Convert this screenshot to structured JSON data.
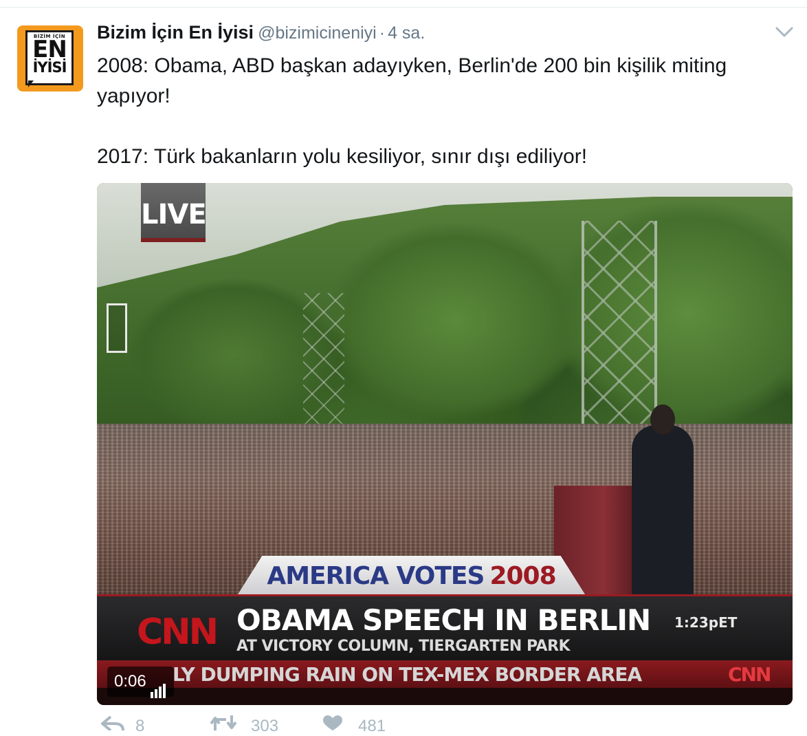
{
  "tweet": {
    "author": {
      "name": "Bizim İçin En İyisi",
      "handle": "@bizimicineniyi",
      "avatar": {
        "top_text": "BİZİM İÇİN",
        "big_text": "EN",
        "bottom_text": "İYİSİ",
        "background_color": "#f39a1e"
      }
    },
    "separator": "·",
    "time": "4 sa.",
    "text_lines": [
      "2008: Obama, ABD başkan adayıyken, Berlin'de 200 bin kişilik miting yapıyor!",
      "2017: Türk bakanların yolu kesiliyor, sınır dışı ediliyor!"
    ],
    "menu_icon": "chevron-down-icon"
  },
  "video": {
    "live_badge": "LIVE",
    "banner_text": "AMERICA VOTES",
    "banner_year": "2008",
    "network_logo": "CNN",
    "headline": "OBAMA SPEECH IN BERLIN",
    "subheadline": "AT VICTORY COLUMN, TIERGARTEN PARK",
    "clock": "1:23pET",
    "ticker_text": "LY DUMPING RAIN ON TEX-MEX BORDER AREA",
    "ticker_logo": "CNN",
    "timer": "0:06",
    "timer_icon": "volume-bars-icon"
  },
  "actions": {
    "reply_count": "8",
    "retweet_count": "303",
    "like_count": "481",
    "reply_icon": "reply-icon",
    "retweet_icon": "retweet-icon",
    "like_icon": "heart-icon",
    "icon_color": "#aab8c2"
  }
}
